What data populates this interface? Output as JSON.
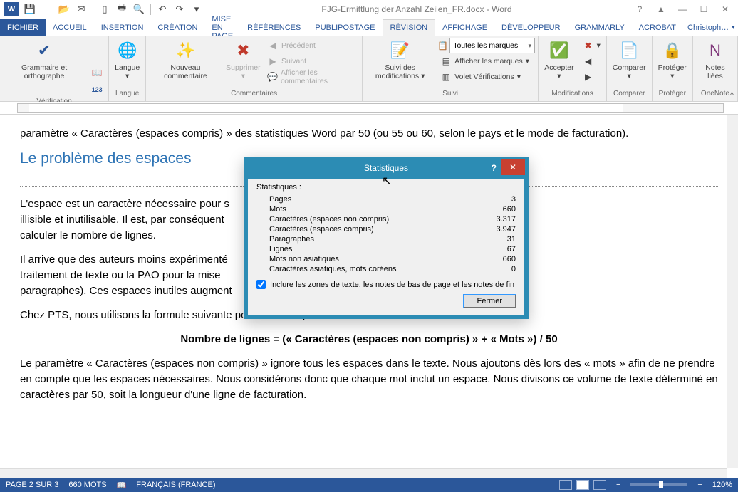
{
  "title": "FJG-Ermittlung der Anzahl Zeilen_FR.docx - Word",
  "account_name": "Christoph…",
  "tabs": [
    "FICHIER",
    "ACCUEIL",
    "INSERTION",
    "CRÉATION",
    "MISE EN PAGE",
    "RÉFÉRENCES",
    "PUBLIPOSTAGE",
    "RÉVISION",
    "AFFICHAGE",
    "DÉVELOPPEUR",
    "GRAMMARLY",
    "ACROBAT"
  ],
  "active_tab_index": 7,
  "ribbon": {
    "verification": {
      "label": "Vérification",
      "btn": "Grammaire et orthographe"
    },
    "langue": {
      "label": "Langue",
      "btn": "Langue"
    },
    "commentaires": {
      "label": "Commentaires",
      "new": "Nouveau commentaire",
      "delete": "Supprimer",
      "prev": "Précédent",
      "next": "Suivant",
      "show": "Afficher les commentaires"
    },
    "suivi": {
      "label": "Suivi",
      "track": "Suivi des modifications",
      "markup_combo": "Toutes les marques",
      "show_markup": "Afficher les marques",
      "pane": "Volet Vérifications"
    },
    "modifications": {
      "label": "Modifications",
      "accept": "Accepter"
    },
    "comparer": {
      "label": "Comparer",
      "btn": "Comparer"
    },
    "proteger": {
      "label": "Protéger",
      "btn": "Protéger"
    },
    "onenote": {
      "label": "OneNote",
      "btn": "Notes liées"
    }
  },
  "document": {
    "p1": "paramètre « Caractères (espaces compris) » des statistiques Word par 50 (ou 55 ou 60, selon le pays et le mode de facturation).",
    "h2": "Le problème des espaces",
    "p2": "L'espace est un caractère nécessaire pour s",
    "p2b": "illisible et inutilisable. Il est, par conséquent",
    "p2c": "calculer le nombre de lignes.",
    "p3": "Il arrive que des auteurs moins expérimenté",
    "p3b": "traitement de texte ou la PAO pour la mise",
    "p3c": "paragraphes). Ces espaces inutiles augment",
    "p4": "Chez PTS, nous utilisons la formule suivante pour éviter ce problème :",
    "formula": "Nombre de lignes = (« Caractères (espaces non compris) » + « Mots ») / 50",
    "p5": "Le paramètre « Caractères (espaces non compris) » ignore tous les espaces dans le texte. Nous ajoutons dès lors des « mots » afin de ne prendre en compte que les espaces nécessaires. Nous considérons donc que chaque mot inclut un espace. Nous divisons ce volume de texte déterminé en caractères par 50, soit la longueur d'une ligne de facturation."
  },
  "dialog": {
    "title": "Statistiques",
    "header": "Statistiques :",
    "rows": [
      {
        "label": "Pages",
        "value": "3"
      },
      {
        "label": "Mots",
        "value": "660"
      },
      {
        "label": "Caractères (espaces non compris)",
        "value": "3.317"
      },
      {
        "label": "Caractères (espaces compris)",
        "value": "3.947"
      },
      {
        "label": "Paragraphes",
        "value": "31"
      },
      {
        "label": "Lignes",
        "value": "67"
      },
      {
        "label": "Mots non asiatiques",
        "value": "660"
      },
      {
        "label": "Caractères asiatiques, mots coréens",
        "value": "0"
      }
    ],
    "checkbox": "Inclure les zones de texte, les notes de bas de page et les notes de fin",
    "close_btn": "Fermer"
  },
  "statusbar": {
    "page": "PAGE 2 SUR 3",
    "words": "660 MOTS",
    "lang": "FRANÇAIS (FRANCE)",
    "zoom": "120%"
  }
}
